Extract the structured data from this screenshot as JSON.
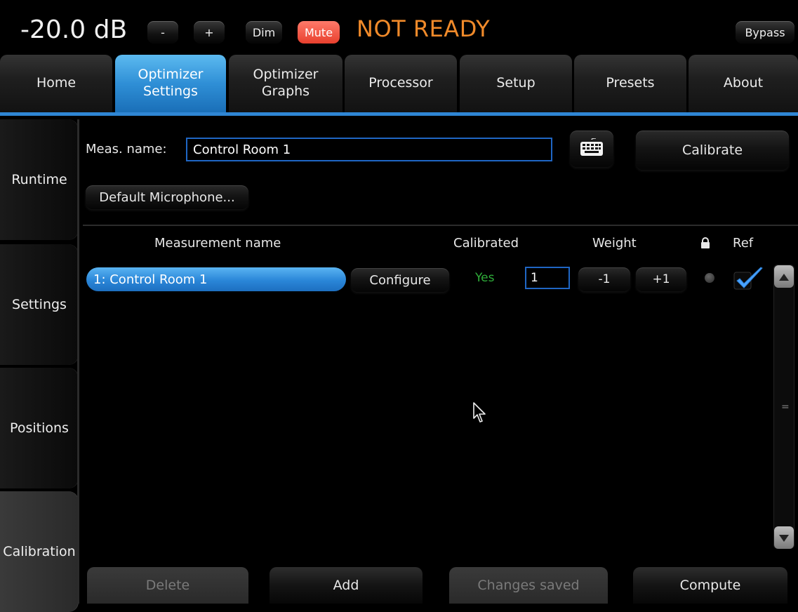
{
  "topbar": {
    "volume": "-20.0 dB",
    "minus_label": "-",
    "plus_label": "+",
    "dim_label": "Dim",
    "mute_label": "Mute",
    "status": "NOT READY",
    "bypass_label": "Bypass"
  },
  "tabs": [
    {
      "label": "Home"
    },
    {
      "label": "Optimizer\nSettings",
      "active": true
    },
    {
      "label": "Optimizer\nGraphs"
    },
    {
      "label": "Processor"
    },
    {
      "label": "Setup"
    },
    {
      "label": "Presets"
    },
    {
      "label": "About"
    }
  ],
  "sidebar": [
    {
      "label": "Runtime"
    },
    {
      "label": "Settings"
    },
    {
      "label": "Positions"
    },
    {
      "label": "Calibration",
      "active": true
    }
  ],
  "meas": {
    "label": "Meas. name:",
    "value": "Control Room 1",
    "calibrate_label": "Calibrate",
    "default_mic_label": "Default Microphone..."
  },
  "table": {
    "headers": {
      "name": "Measurement name",
      "calibrated": "Calibrated",
      "weight": "Weight",
      "ref": "Ref"
    },
    "rows": [
      {
        "name": "1: Control Room 1",
        "configure_label": "Configure",
        "calibrated": "Yes",
        "weight": "1",
        "minus_label": "-1",
        "plus_label": "+1",
        "ref_checked": true
      }
    ]
  },
  "bottom": {
    "delete_label": "Delete",
    "add_label": "Add",
    "saved_label": "Changes saved",
    "compute_label": "Compute"
  },
  "colors": {
    "accent_blue": "#2f86d4",
    "status_orange": "#f08a2a",
    "mute_red": "#e8402e",
    "yes_green": "#2fae3a"
  }
}
